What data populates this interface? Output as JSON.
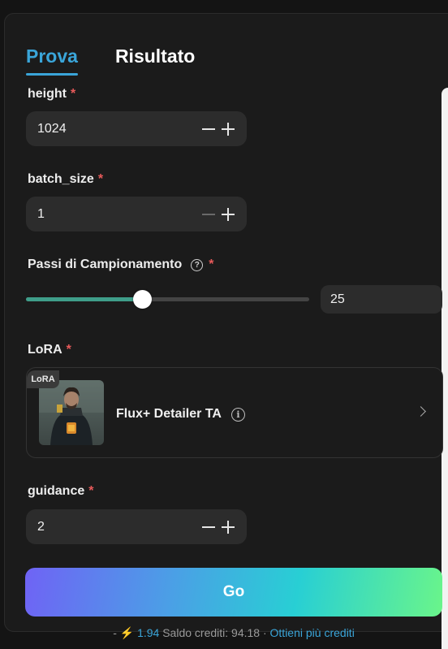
{
  "tabs": [
    {
      "label": "Prova",
      "active": true
    },
    {
      "label": "Risultato",
      "active": false
    }
  ],
  "height": {
    "label": "height",
    "required": "*",
    "value": "1024"
  },
  "batch_size": {
    "label": "batch_size",
    "required": "*",
    "value": "1"
  },
  "steps": {
    "label": "Passi di Campionamento",
    "required": "*",
    "help_icon": "?",
    "value": "25",
    "level_fraction": 0.41
  },
  "lora": {
    "label": "LoRA",
    "required": "*",
    "badge": "LoRA",
    "name": "Flux+ Detailer TA",
    "info_icon": "i"
  },
  "guidance": {
    "label": "guidance",
    "required": "*",
    "value": "2"
  },
  "go_button": {
    "label": "Go"
  },
  "footer": {
    "dash": "-",
    "cost_icon": "⚡",
    "cost": "1.94",
    "balance": "Saldo crediti: 94.18",
    "separator": "·",
    "more_link": "Ottieni più crediti"
  },
  "colors": {
    "accent": "#3aa5d9",
    "required": "#e85a5a",
    "slider_fill": "#3f9e8a"
  }
}
